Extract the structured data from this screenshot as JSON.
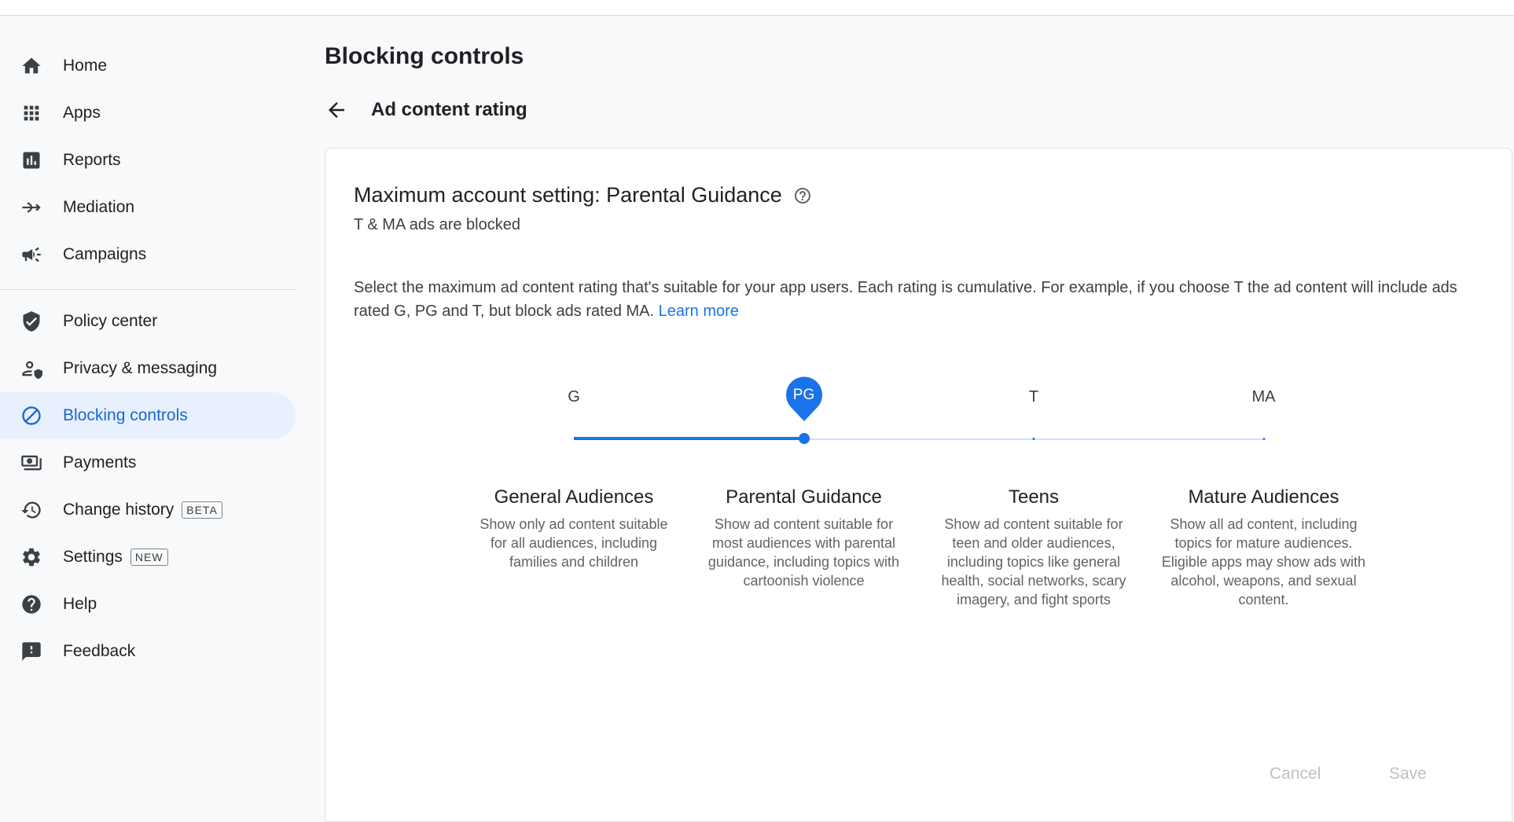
{
  "sidebar": {
    "primary": [
      {
        "label": "Home",
        "icon": "home-icon"
      },
      {
        "label": "Apps",
        "icon": "apps-grid-icon"
      },
      {
        "label": "Reports",
        "icon": "bar-chart-icon"
      },
      {
        "label": "Mediation",
        "icon": "mediation-icon"
      },
      {
        "label": "Campaigns",
        "icon": "megaphone-icon"
      }
    ],
    "secondary": [
      {
        "label": "Policy center",
        "icon": "shield-check-icon"
      },
      {
        "label": "Privacy & messaging",
        "icon": "privacy-person-icon"
      },
      {
        "label": "Blocking controls",
        "icon": "block-icon",
        "active": true
      },
      {
        "label": "Payments",
        "icon": "payments-icon"
      },
      {
        "label": "Change history",
        "icon": "history-icon",
        "tag": "BETA"
      },
      {
        "label": "Settings",
        "icon": "gear-icon",
        "tag": "NEW"
      },
      {
        "label": "Help",
        "icon": "help-circle-icon"
      },
      {
        "label": "Feedback",
        "icon": "feedback-icon"
      }
    ]
  },
  "main": {
    "title": "Blocking controls",
    "subtitle": "Ad content rating",
    "card": {
      "heading": "Maximum account setting: Parental Guidance",
      "status": "T & MA ads are blocked",
      "description": "Select the maximum ad content rating that's suitable for your app users. Each rating is cumulative. For example, if you choose T the ad content will include ads rated G, PG and T, but block ads rated MA.",
      "learn_more": "Learn more",
      "slider": {
        "selected_index": 1,
        "ticks": [
          "G",
          "PG",
          "T",
          "MA"
        ],
        "accent": "#1a73e8"
      },
      "levels": [
        {
          "title": "General Audiences",
          "desc": "Show only ad content suitable for all audiences, including families and children"
        },
        {
          "title": "Parental Guidance",
          "desc": "Show ad content suitable for most audiences with parental guidance, including topics with cartoonish violence"
        },
        {
          "title": "Teens",
          "desc": "Show ad content suitable for teen and older audiences, including topics like general health, social networks, scary imagery, and fight sports"
        },
        {
          "title": "Mature Audiences",
          "desc": "Show all ad content, including topics for mature audiences. Eligible apps may show ads with alcohol, weapons, and sexual content."
        }
      ],
      "cancel_label": "Cancel",
      "save_label": "Save"
    }
  }
}
